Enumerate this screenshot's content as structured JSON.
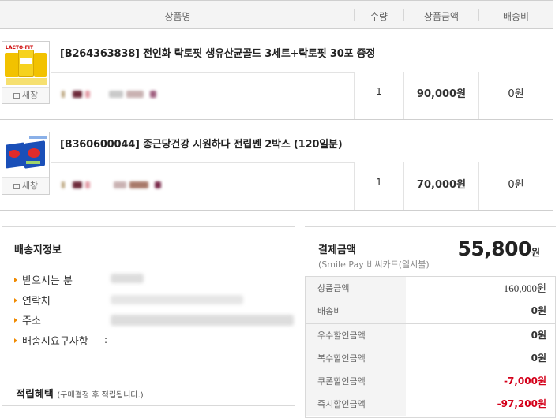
{
  "header": {
    "product_name": "상품명",
    "quantity": "수량",
    "amount": "상품금액",
    "shipping": "배송비"
  },
  "items": [
    {
      "title": "[B264363838] 전인화 락토핏 생유산균골드 3세트+락토핏 30포 증정",
      "new_window_label": "새창",
      "quantity": "1",
      "amount": "90,000원",
      "shipping": "0원"
    },
    {
      "title": "[B360600044] 종근당건강 시원하다 전립쎈 2박스 (120일분)",
      "new_window_label": "새창",
      "quantity": "1",
      "amount": "70,000원",
      "shipping": "0원"
    }
  ],
  "shipping_info": {
    "title": "배송지정보",
    "fields": [
      {
        "label": "받으시는 분"
      },
      {
        "label": "연락처"
      },
      {
        "label": "주소"
      },
      {
        "label": "배송시요구사항",
        "value": ":"
      }
    ]
  },
  "points": {
    "title": "적립혜택",
    "note": "(구매결정 후 적립됩니다.)"
  },
  "payment": {
    "title": "결제금액",
    "method": "(Smile Pay 비씨카드(일시불)",
    "total_number": "55,800",
    "total_unit": "원",
    "rows": [
      {
        "label": "상품금액",
        "value": "160,000원",
        "negative": false
      },
      {
        "label": "배송비",
        "value": "0원",
        "negative": false
      },
      {
        "label": "우수할인금액",
        "value": "0원",
        "negative": false
      },
      {
        "label": "복수할인금액",
        "value": "0원",
        "negative": false
      },
      {
        "label": "쿠폰할인금액",
        "value": "-7,000원",
        "negative": true
      },
      {
        "label": "즉시할인금액",
        "value": "-97,200원",
        "negative": true
      }
    ]
  },
  "colors": {
    "accent_orange": "#f08a00",
    "discount_red": "#d4001a",
    "header_bg": "#f4f4f4"
  }
}
